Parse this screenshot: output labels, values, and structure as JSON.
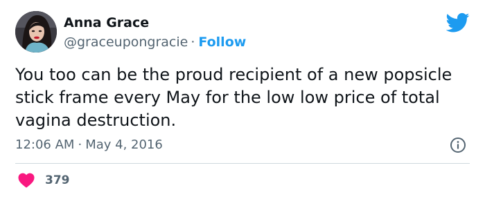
{
  "author": {
    "name": "Anna Grace",
    "handle": "@graceupongracie",
    "separator": "·",
    "follow_label": "Follow"
  },
  "tweet": {
    "text": "You too can be the proud recipient of a new popsicle stick frame every May for the low low price of total vagina destruction.",
    "time": "12:06 AM",
    "date": "May 4, 2016",
    "separator": "·"
  },
  "engagement": {
    "likes": "379"
  },
  "icons": {
    "brand": "twitter-bird-icon",
    "info": "info-icon",
    "like": "heart-icon"
  },
  "colors": {
    "accent": "#1d9bf0",
    "like": "#f91880",
    "secondary_text": "#536471"
  }
}
